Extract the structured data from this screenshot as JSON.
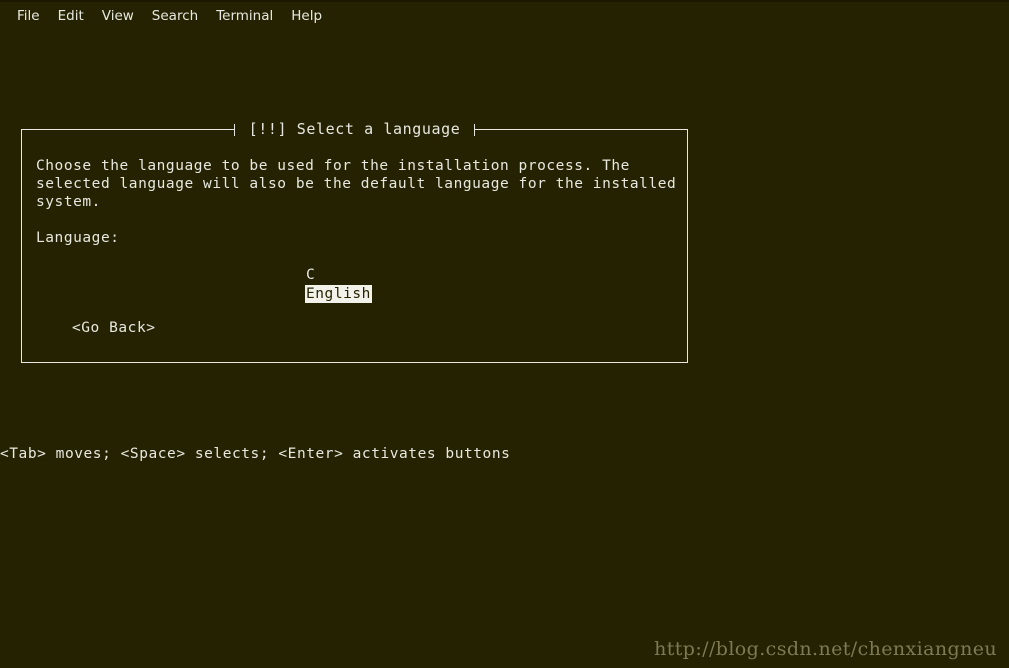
{
  "terminal": {
    "background_color": "#242200",
    "foreground_color": "#e8e8e0",
    "highlight_background": "#f2f2ea",
    "highlight_foreground": "#242200"
  },
  "menubar": {
    "items": [
      {
        "label": "File"
      },
      {
        "label": "Edit"
      },
      {
        "label": "View"
      },
      {
        "label": "Search"
      },
      {
        "label": "Terminal"
      },
      {
        "label": "Help"
      }
    ]
  },
  "dialog": {
    "title": "[!!] Select a language",
    "description_lines": [
      "Choose the language to be used for the installation process. The",
      "selected language will also be the default language for the installed",
      "system."
    ],
    "language_label": "Language:",
    "language_options": [
      {
        "label": "C",
        "selected": false
      },
      {
        "label": "English",
        "selected": true
      }
    ],
    "buttons": [
      {
        "label": "<Go Back>",
        "selected": false
      }
    ]
  },
  "footer": {
    "hint": "<Tab> moves; <Space> selects; <Enter> activates buttons"
  },
  "watermark": {
    "text": "http://blog.csdn.net/chenxiangneu"
  }
}
